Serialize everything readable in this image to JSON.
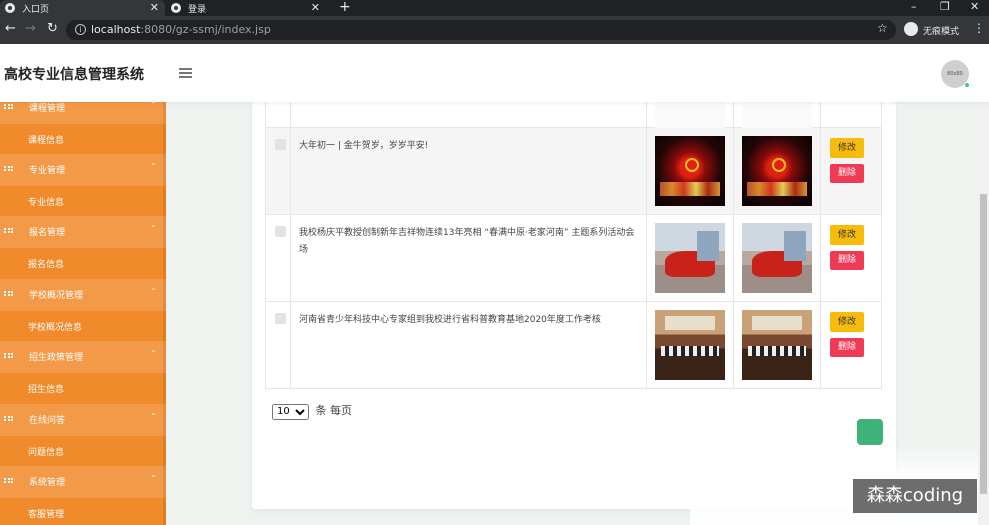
{
  "browser": {
    "tabs": [
      {
        "label": "入口页",
        "active": true
      },
      {
        "label": "登录",
        "active": false
      }
    ],
    "url_host": "localhost",
    "url_rest": ":8080/gz-ssmj/index.jsp",
    "incognito_label": "无痕模式",
    "window_controls": [
      "–",
      "❐",
      "✕"
    ]
  },
  "header": {
    "title": "高校专业信息管理系统",
    "avatar_text": "80x80"
  },
  "sidebar": {
    "items": [
      {
        "group": "课程管理",
        "sub": "课程信息"
      },
      {
        "group": "专业管理",
        "sub": "专业信息"
      },
      {
        "group": "报名管理",
        "sub": "报名信息"
      },
      {
        "group": "学校概况管理",
        "sub": "学校概况信息"
      },
      {
        "group": "招生政策管理",
        "sub": "招生信息"
      },
      {
        "group": "在线问答",
        "sub": "问题信息"
      },
      {
        "group": "系统管理",
        "sub": "客服管理"
      }
    ]
  },
  "table": {
    "rows": [
      {
        "text": "",
        "image": "partial-logo",
        "edit": "",
        "delete": ""
      },
      {
        "text": "大年初一 | 金牛贺岁，岁岁平安!",
        "image": "festival-lanterns",
        "edit": "修改",
        "delete": "删除"
      },
      {
        "text": "我校杨庆平教授创制新年吉祥物连续13年亮相 “春满中原·老家河南” 主题系列活动会场",
        "image": "red-sculpture",
        "edit": "修改",
        "delete": "删除"
      },
      {
        "text": "河南省青少年科技中心专家组到我校进行省科普教育基地2020年度工作考核",
        "image": "meeting-room",
        "edit": "修改",
        "delete": "删除"
      }
    ]
  },
  "pager": {
    "page_size": "10",
    "suffix": "条 每页"
  },
  "watermark": "森森coding",
  "colors": {
    "sidebar": "#f08a2b",
    "sidebar_group": "#f39a48",
    "edit_button": "#f7bb0c",
    "delete_button": "#ee3a54"
  }
}
